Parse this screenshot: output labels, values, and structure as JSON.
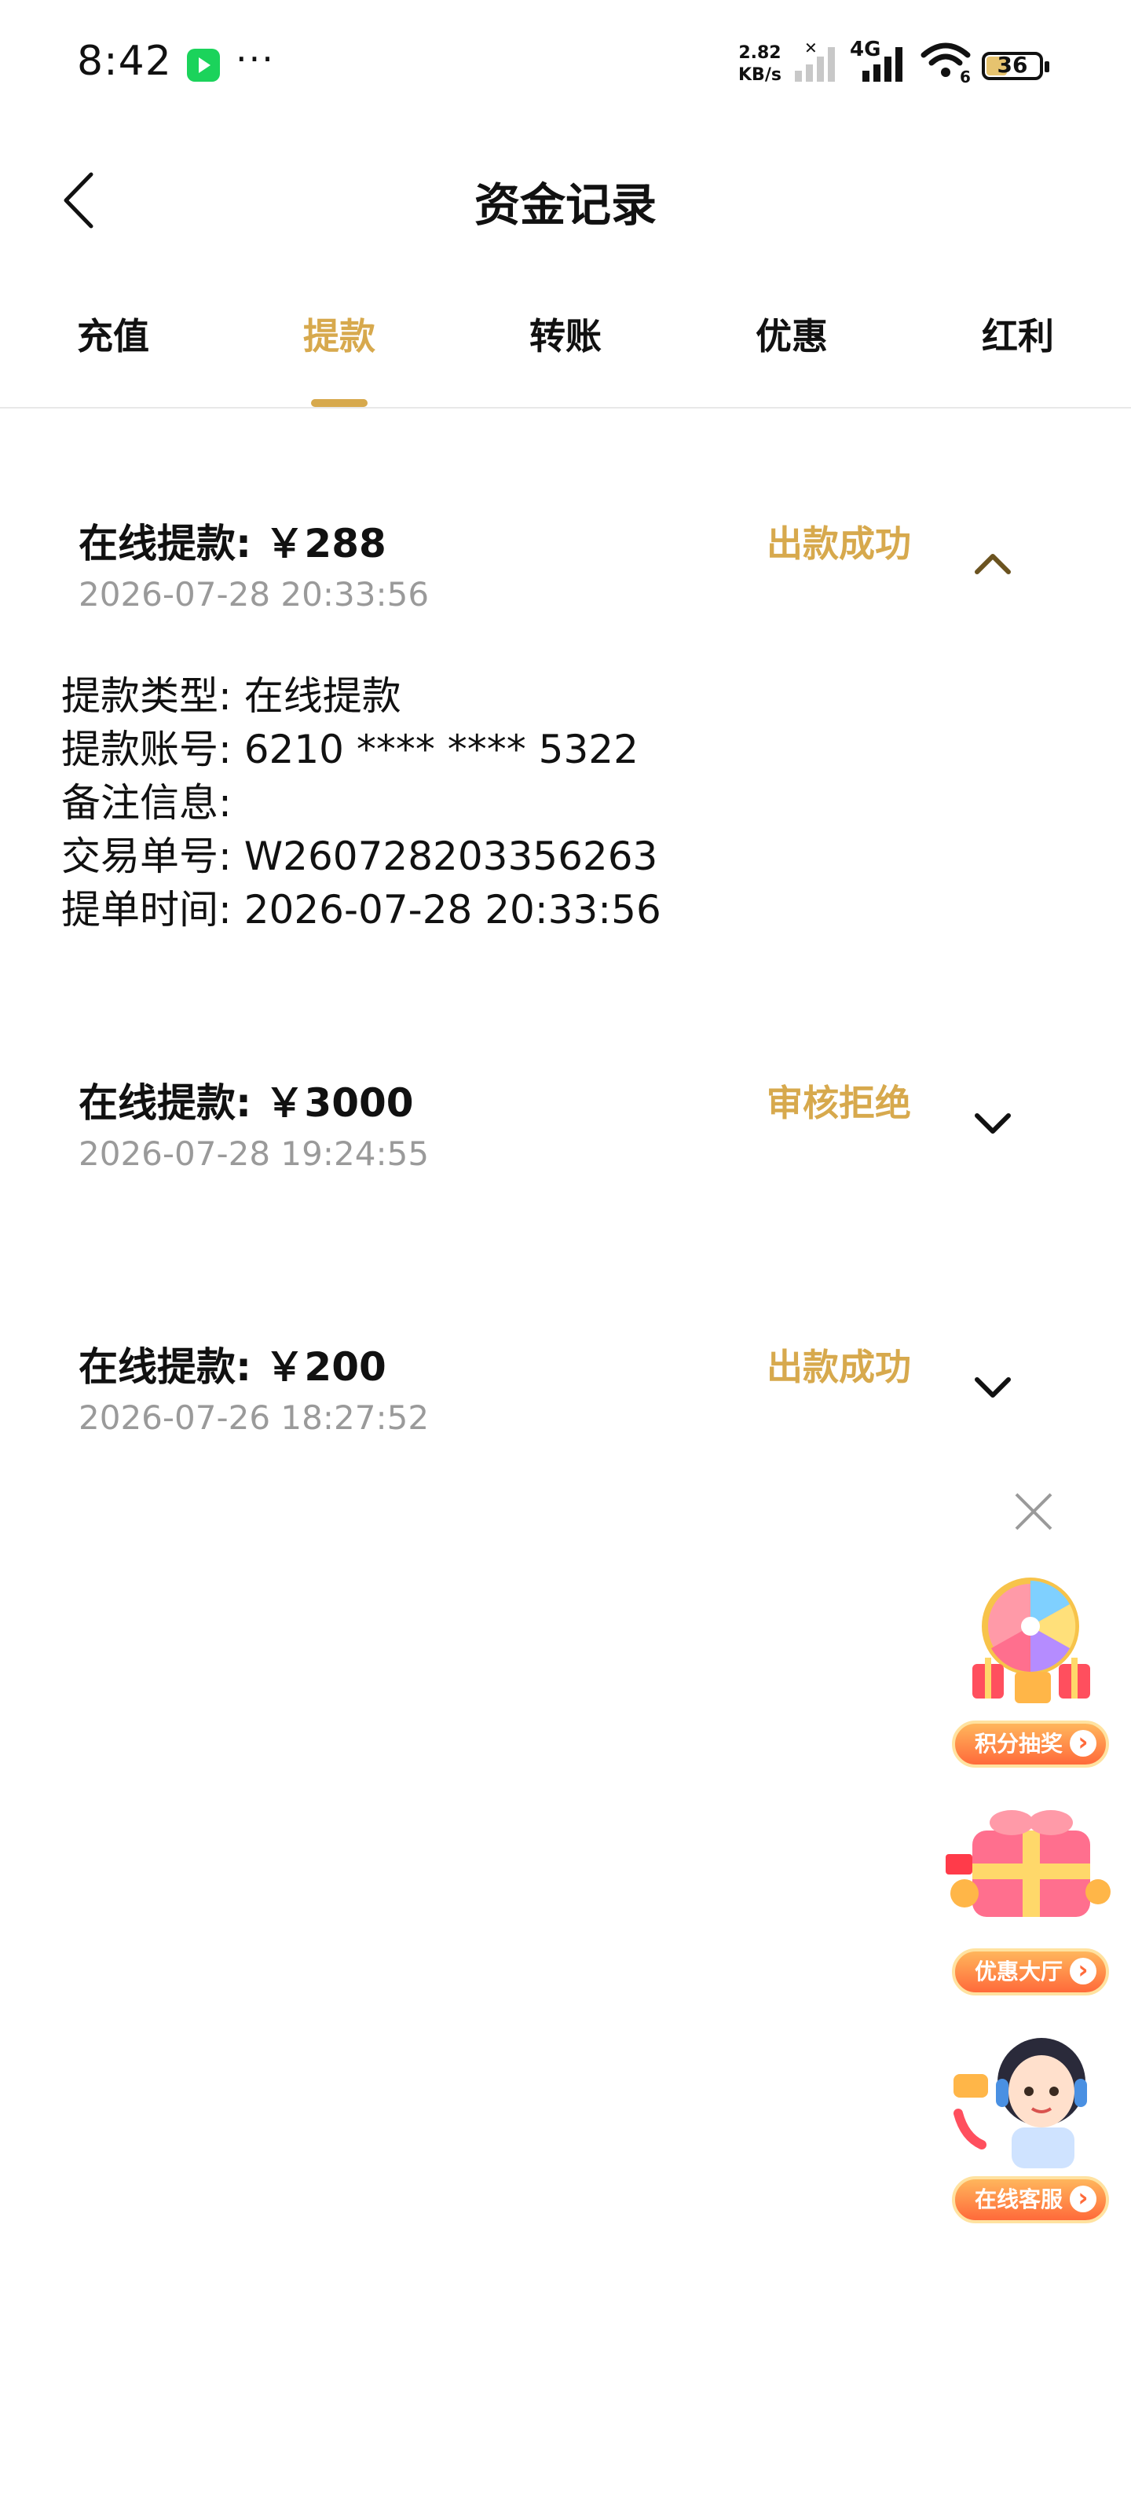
{
  "status_bar": {
    "time": "8:42",
    "net_speed_value": "2.82",
    "net_speed_unit": "KB/s",
    "network_type": "4G",
    "wifi_index": "6",
    "battery": "36"
  },
  "header": {
    "title": "资金记录"
  },
  "tabs": [
    {
      "label": "充值"
    },
    {
      "label": "提款",
      "active": true
    },
    {
      "label": "转账"
    },
    {
      "label": "优惠"
    },
    {
      "label": "红利"
    }
  ],
  "records": [
    {
      "title": "在线提款: ￥288",
      "time": "2026-07-28 20:33:56",
      "status": "出款成功",
      "expanded": true,
      "details": [
        "提款类型: 在线提款",
        "提款账号: 6210 **** **** 5322",
        "备注信息:",
        "交易单号: W260728203356263",
        "提单时间: 2026-07-28 20:33:56"
      ]
    },
    {
      "title": "在线提款: ￥3000",
      "time": "2026-07-28 19:24:55",
      "status": "审核拒绝",
      "expanded": false
    },
    {
      "title": "在线提款: ￥200",
      "time": "2026-07-26 18:27:52",
      "status": "出款成功",
      "expanded": false
    }
  ],
  "floating": {
    "items": [
      {
        "label": "积分抽奖",
        "icon": "lucky-wheel-icon"
      },
      {
        "label": "优惠大厅",
        "icon": "gift-box-icon"
      },
      {
        "label": "在线客服",
        "icon": "customer-service-icon"
      }
    ]
  },
  "colors": {
    "accent": "#d7a94d",
    "muted": "#9a9a9a",
    "text": "#111111"
  }
}
